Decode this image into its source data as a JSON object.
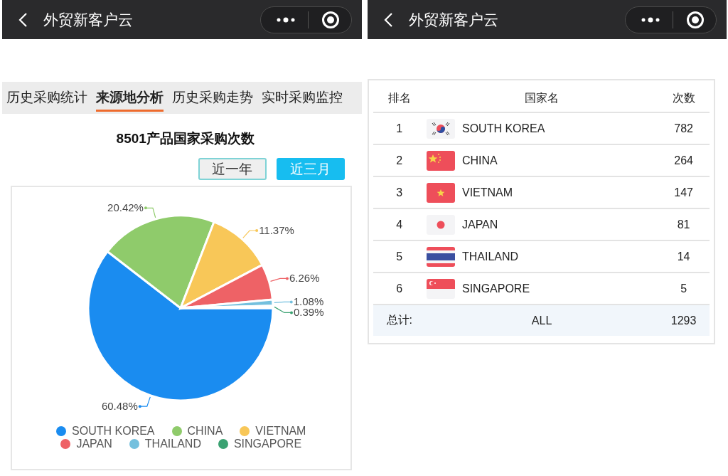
{
  "left_screen": {
    "nav_bar": {
      "title": "外贸新客户云"
    },
    "tabs": [
      {
        "label": "历史采购统计",
        "selected": false
      },
      {
        "label": "来源地分析",
        "selected": true
      },
      {
        "label": "历史采购走势",
        "selected": false
      },
      {
        "label": "实时采购监控",
        "selected": false
      }
    ],
    "chart_title": "8501产品国家采购次数",
    "range_buttons": [
      {
        "label": "近一年",
        "selected": false
      },
      {
        "label": "近三月",
        "selected": true
      }
    ],
    "chart_data": {
      "type": "pie",
      "categories": [
        "SOUTH KOREA",
        "CHINA",
        "VIETNAM",
        "JAPAN",
        "THAILAND",
        "SINGAPORE"
      ],
      "values": [
        60.48,
        20.42,
        11.37,
        6.26,
        1.08,
        0.39
      ],
      "colors": [
        "#1a8cf0",
        "#8fcb6b",
        "#f8c758",
        "#ee6266",
        "#74c0de",
        "#3ba272"
      ],
      "value_labels": [
        "60.48%",
        "20.42%",
        "11.37%",
        "6.26%",
        "1.08%",
        "0.39%"
      ]
    }
  },
  "right_screen": {
    "nav_bar": {
      "title": "外贸新客户云"
    },
    "table": {
      "columns": [
        "排名",
        "国家名",
        "次数"
      ],
      "rows": [
        {
          "rank": "1",
          "kind": "kr",
          "country": "SOUTH KOREA",
          "count": "782"
        },
        {
          "rank": "2",
          "kind": "cn",
          "country": "CHINA",
          "count": "264"
        },
        {
          "rank": "3",
          "kind": "vn",
          "country": "VIETNAM",
          "count": "147"
        },
        {
          "rank": "4",
          "kind": "jp",
          "country": "JAPAN",
          "count": "81"
        },
        {
          "rank": "5",
          "kind": "th",
          "country": "THAILAND",
          "count": "14"
        },
        {
          "rank": "6",
          "kind": "sg",
          "country": "SINGAPORE",
          "count": "5"
        }
      ],
      "total": {
        "label": "总计:",
        "country": "ALL",
        "count": "1293"
      }
    }
  }
}
